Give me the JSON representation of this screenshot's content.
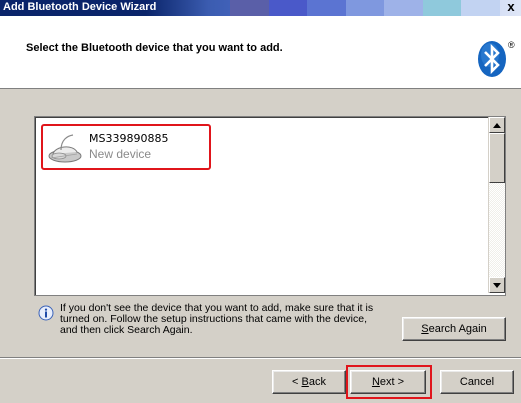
{
  "window": {
    "title": "Add Bluetooth Device Wizard",
    "close_glyph": "x"
  },
  "header": {
    "title": "Select the Bluetooth device that you want to add.",
    "logo_icon": "bluetooth-logo-icon",
    "registered_mark": "®"
  },
  "devices": [
    {
      "name": "MS339890885",
      "status": "New device",
      "icon": "mouse-device-icon"
    }
  ],
  "info": {
    "icon": "info-icon",
    "line1": "If you don't see the device that you want to add, make sure that it is",
    "line2": "turned on. Follow the setup instructions that came with the device,",
    "line3": "and then click Search Again."
  },
  "buttons": {
    "search_again": {
      "mnemonic": "S",
      "rest": "earch Again"
    },
    "back": {
      "prefix": "< ",
      "mnemonic": "B",
      "rest": "ack"
    },
    "next": {
      "mnemonic": "N",
      "rest": "ext >"
    },
    "cancel": "Cancel"
  },
  "colors": {
    "highlight": "#e0151b",
    "title_bar": "#0a246a",
    "bluetooth": "#1565c0"
  }
}
